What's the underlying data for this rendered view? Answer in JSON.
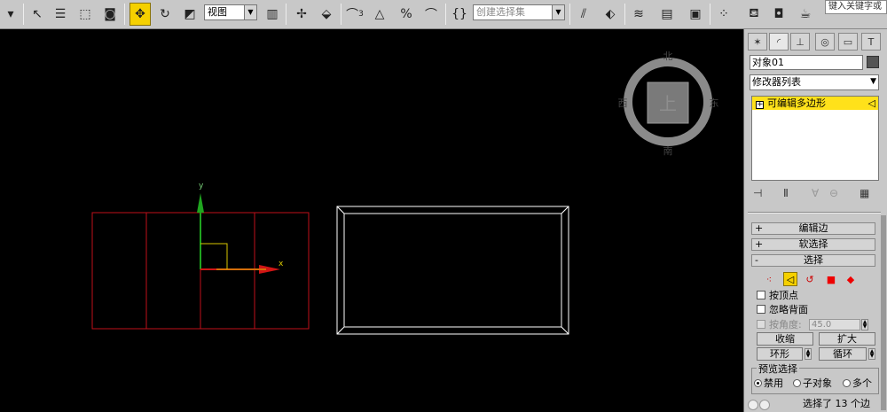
{
  "toolbar": {
    "view_dropdown": "视图",
    "selection_set_dropdown": "创建选择集",
    "search_placeholder": "键入关键字或",
    "snap_label": "3",
    "percent_label": "%"
  },
  "viewport": {
    "viewcube": {
      "top_face": "上",
      "north": "北",
      "south": "南",
      "east": "东",
      "west": "西"
    },
    "gizmo": {
      "x_label": "x",
      "y_label": "y"
    }
  },
  "panel": {
    "object_name": "对象01",
    "modifier_list": "修改器列表",
    "stack_item": "可编辑多边形",
    "rollups": {
      "edit_edges": "编辑边",
      "soft_selection": "软选择",
      "selection": "选择",
      "plus": "+",
      "minus": "-"
    },
    "selection": {
      "by_vertex": "按顶点",
      "ignore_backfacing": "忽略背面",
      "by_angle": "按角度:",
      "angle_value": "45.0",
      "shrink": "收缩",
      "grow": "扩大",
      "ring": "环形",
      "loop": "循环"
    },
    "preview_selection": {
      "legend": "预览选择",
      "disabled": "禁用",
      "subobject": "子对象",
      "multi": "多个"
    },
    "status": "选择了 13 个边"
  },
  "colors": {
    "active_yellow": "#f5d000",
    "object_red": "#c0101a",
    "object_white": "#ffffff",
    "gizmo_green": "#1fa51f",
    "gizmo_red": "#d01515",
    "panel_bg": "#c8c8c8"
  }
}
